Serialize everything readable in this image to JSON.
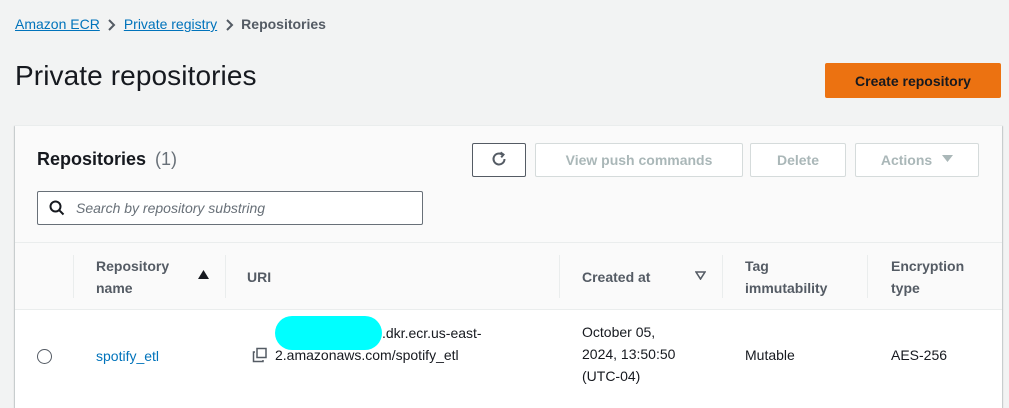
{
  "breadcrumb": {
    "items": [
      "Amazon ECR",
      "Private registry"
    ],
    "current": "Repositories"
  },
  "page": {
    "title": "Private repositories",
    "create_button": "Create repository"
  },
  "panel": {
    "heading": "Repositories",
    "count": "(1)",
    "buttons": {
      "view_push": "View push commands",
      "delete": "Delete",
      "actions": "Actions"
    },
    "search": {
      "placeholder": "Search by repository substring",
      "value": ""
    }
  },
  "table": {
    "columns": {
      "repo_name_line1": "Repository",
      "repo_name_line2": "name",
      "uri": "URI",
      "created_at": "Created at",
      "tag_line1": "Tag",
      "tag_line2": "immutability",
      "enc_line1": "Encryption",
      "enc_line2": "type"
    },
    "rows": [
      {
        "name": "spotify_etl",
        "uri_line1_suffix": ".dkr.ecr.us-east-",
        "uri_line2": "2.amazonaws.com/spotify_etl",
        "created_line1": "October 05,",
        "created_line2": "2024, 13:50:50",
        "created_line3": "(UTC-04)",
        "tag_immutability": "Mutable",
        "encryption": "AES-256"
      }
    ]
  },
  "colors": {
    "accent_orange": "#ec7211",
    "link_blue": "#0073bb",
    "redaction_cyan": "#00ffff"
  },
  "icons": [
    "chevron-right-icon",
    "refresh-icon",
    "caret-down-icon",
    "search-icon",
    "sort-ascending-icon",
    "sort-icon",
    "copy-icon"
  ]
}
